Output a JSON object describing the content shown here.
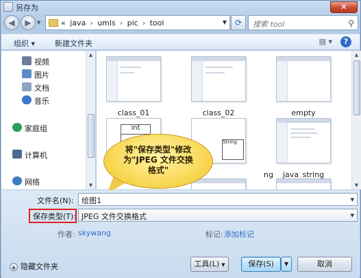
{
  "window": {
    "title": "另存为",
    "close_label": "✕"
  },
  "nav": {
    "path": [
      "«",
      "java",
      "umls",
      "pic",
      "tool"
    ],
    "search_placeholder": "搜索 tool"
  },
  "toolbar": {
    "organize": "组织 ▾",
    "new_folder": "新建文件夹"
  },
  "sidebar": {
    "items": [
      {
        "label": "视频",
        "icon": "video-icon",
        "color": "#6b7d97"
      },
      {
        "label": "图片",
        "icon": "picture-icon",
        "color": "#5b8cc8"
      },
      {
        "label": "文档",
        "icon": "document-icon",
        "color": "#8ea5c2"
      },
      {
        "label": "音乐",
        "icon": "music-icon",
        "color": "#3a78c8"
      },
      {
        "label": "家庭组",
        "icon": "homegroup-icon",
        "color": "#2e9c5a"
      },
      {
        "label": "计算机",
        "icon": "computer-icon",
        "color": "#4a6a92"
      },
      {
        "label": "网络",
        "icon": "network-icon",
        "color": "#3f7fc0"
      }
    ]
  },
  "files": [
    {
      "label": "class_01"
    },
    {
      "label": "class_02"
    },
    {
      "label": "empty"
    },
    {
      "label": ""
    },
    {
      "label": "ng"
    },
    {
      "label": "java_string"
    }
  ],
  "thumb_text": {
    "int": "int",
    "string": "String"
  },
  "callout": {
    "line1": "将\"保存类型\"修改",
    "line2": "为\"JPEG 文件交换",
    "line3": "格式\""
  },
  "form": {
    "filename_label": "文件名(N):",
    "filename_value": "绘图1",
    "type_label": "保存类型(T):",
    "type_value": "JPEG 文件交换格式",
    "author_label": "作者:",
    "author_value": "skywang",
    "tags_label": "标记:",
    "tags_value": "添加标记",
    "hide_folders": "隐藏文件夹",
    "tools": "工具(L)",
    "save": "保存(S)",
    "cancel": "取消"
  },
  "colors": {
    "highlight_border": "#e02020",
    "link": "#2f6fc8"
  }
}
